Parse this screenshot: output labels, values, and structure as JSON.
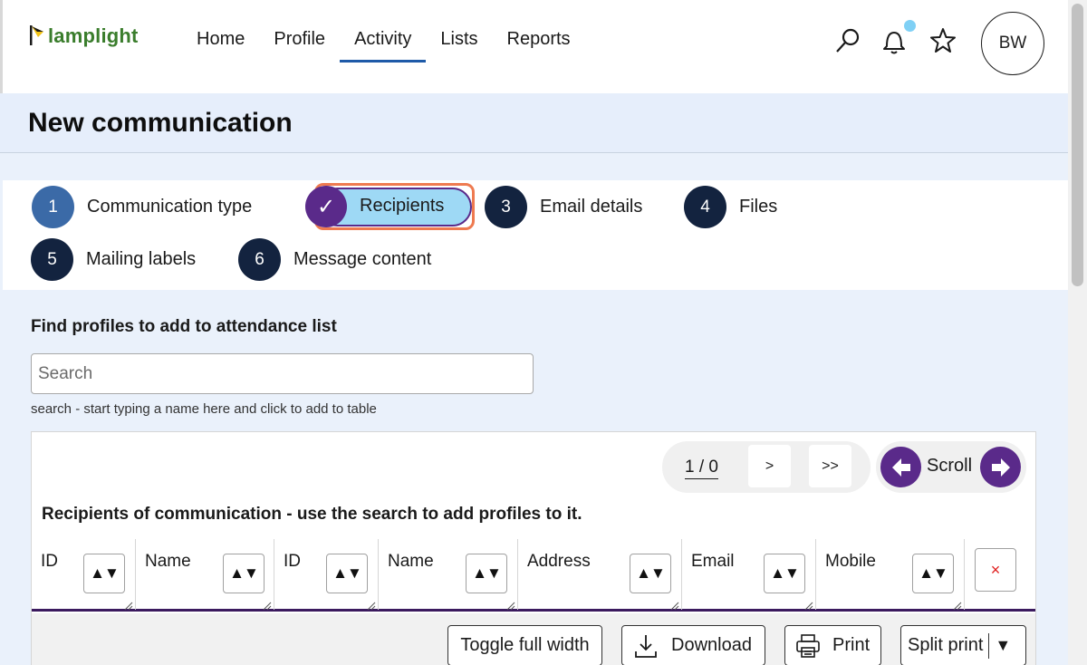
{
  "app": {
    "logo_text": "lamplight"
  },
  "nav": {
    "items": [
      {
        "label": "Home"
      },
      {
        "label": "Profile"
      },
      {
        "label": "Activity"
      },
      {
        "label": "Lists"
      },
      {
        "label": "Reports"
      }
    ],
    "active": "Activity"
  },
  "user": {
    "initials": "BW"
  },
  "page": {
    "title": "New communication"
  },
  "steps": [
    {
      "number": "1",
      "label": "Communication type"
    },
    {
      "number": "✓",
      "label": "Recipients",
      "active": true
    },
    {
      "number": "3",
      "label": "Email details"
    },
    {
      "number": "4",
      "label": "Files"
    },
    {
      "number": "5",
      "label": "Mailing labels"
    },
    {
      "number": "6",
      "label": "Message content"
    }
  ],
  "find": {
    "title": "Find profiles to add to attendance list",
    "placeholder": "Search",
    "help": "search - start typing a name here and click to add to table"
  },
  "pager": {
    "count": "1 / 0",
    "next_label": ">",
    "last_label": ">>"
  },
  "scroll": {
    "label": "Scroll"
  },
  "table": {
    "caption": "Recipients of communication - use the search to add profiles to it.",
    "columns": [
      "ID",
      "Name",
      "ID",
      "Name",
      "Address",
      "Email",
      "Mobile"
    ],
    "sort_glyph": "▲▼",
    "clear_glyph": "×"
  },
  "footer": {
    "toggle_label": "Toggle full width",
    "download_label": "Download",
    "print_label": "Print",
    "split_print_label": "Split print",
    "split_arrow": "▼"
  },
  "colors": {
    "accent_purple": "#5a2a8a",
    "nav_underline": "#1e5aa8",
    "step_dark": "#13233f",
    "active_pill": "#9ed9f5",
    "highlight": "#ee7a50",
    "logo_green": "#3a7d2c"
  }
}
